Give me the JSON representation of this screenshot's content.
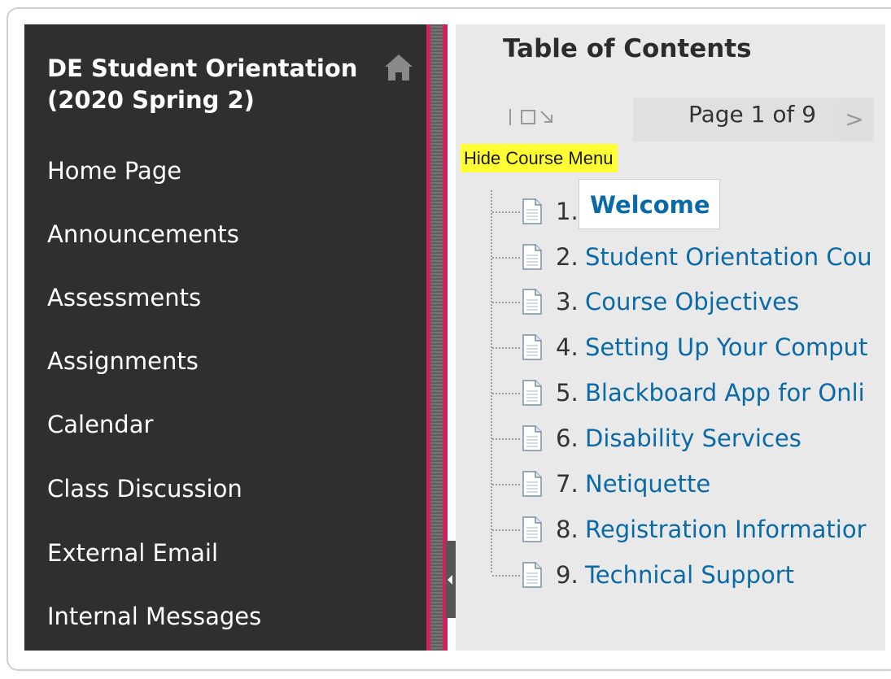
{
  "course": {
    "title": "DE Student Orientation (2020 Spring 2)"
  },
  "menu": {
    "items": [
      {
        "label": "Home Page"
      },
      {
        "label": "Announcements"
      },
      {
        "label": "Assessments"
      },
      {
        "label": "Assignments"
      },
      {
        "label": "Calendar"
      },
      {
        "label": "Class Discussion"
      },
      {
        "label": "External Email"
      },
      {
        "label": "Internal Messages"
      }
    ]
  },
  "content": {
    "title": "Table of Contents",
    "page_label": "Page 1 of 9",
    "next_symbol": ">",
    "hide_menu_label": "Hide Course Menu",
    "toc": [
      {
        "num": "1.",
        "label": "Welcome",
        "active": true
      },
      {
        "num": "2.",
        "label": "Student Orientation Cou"
      },
      {
        "num": "3.",
        "label": "Course Objectives"
      },
      {
        "num": "4.",
        "label": "Setting Up Your Comput"
      },
      {
        "num": "5.",
        "label": "Blackboard App for Onli"
      },
      {
        "num": "6.",
        "label": "Disability Services"
      },
      {
        "num": "7.",
        "label": "Netiquette"
      },
      {
        "num": "8.",
        "label": "Registration Informatior"
      },
      {
        "num": "9.",
        "label": "Technical Support"
      }
    ]
  },
  "icons": {
    "home": "home-icon",
    "document": "document-icon",
    "toolbar": [
      "text-cursor-icon",
      "square-icon",
      "arrow-down-right-icon"
    ]
  },
  "colors": {
    "sidebar_bg": "#2f2f2f",
    "accent_pink": "#d21f5f",
    "link_blue": "#0a6aa8",
    "highlight_yellow": "#ffff33",
    "content_bg": "#e9e9e9"
  }
}
